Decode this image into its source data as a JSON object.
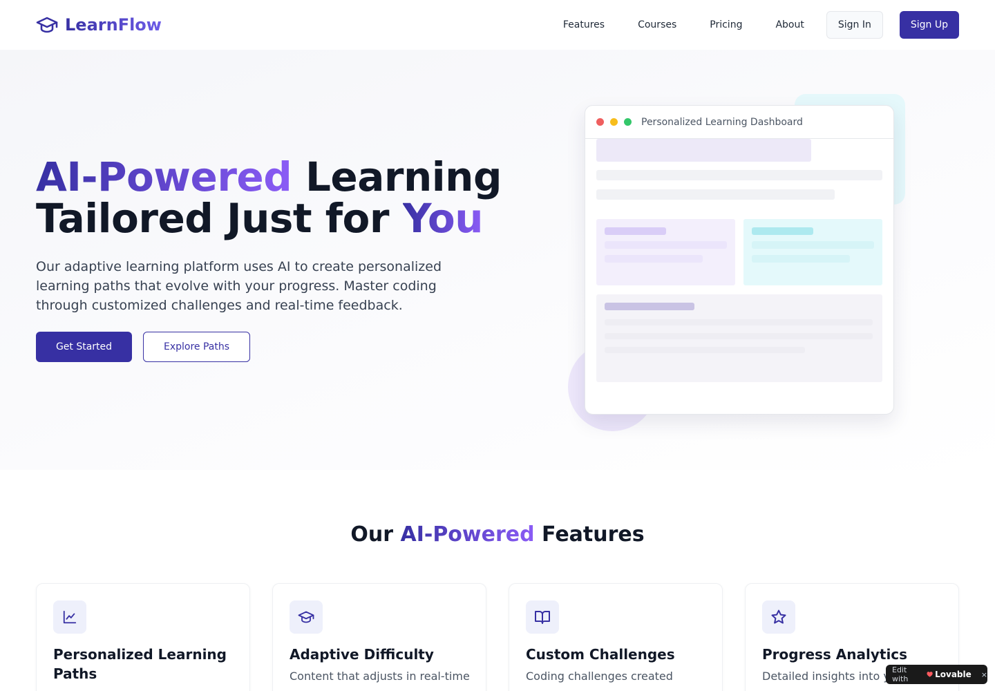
{
  "nav": {
    "brand": "LearnFlow",
    "links": [
      "Features",
      "Courses",
      "Pricing",
      "About"
    ],
    "sign_in": "Sign In",
    "sign_up": "Sign Up"
  },
  "hero": {
    "title_part1": "AI-Powered",
    "title_part2": " Learning",
    "title_part3": "Tailored Just for ",
    "title_part4": "You",
    "subtitle": "Our adaptive learning platform uses AI to create personalized learning paths that evolve with your progress. Master coding through customized challenges and real-time feedback.",
    "cta_primary": "Get Started",
    "cta_secondary": "Explore Paths",
    "dashboard_title": "Personalized Learning Dashboard"
  },
  "features": {
    "heading_part1": "Our ",
    "heading_part2": "AI-Powered",
    "heading_part3": " Features",
    "cards": [
      {
        "icon": "line-chart-icon",
        "title": "Personalized Learning Paths",
        "description": ""
      },
      {
        "icon": "graduation-cap-icon",
        "title": "Adaptive Difficulty",
        "description": "Content that adjusts in real-time"
      },
      {
        "icon": "book-open-icon",
        "title": "Custom Challenges",
        "description": "Coding challenges created"
      },
      {
        "icon": "star-icon",
        "title": "Progress Analytics",
        "description": "Detailed insights into yo"
      }
    ]
  },
  "badge": {
    "prefix": "Edit with",
    "brand": "Lovable",
    "close": "×"
  },
  "colors": {
    "primary": "#3730a3",
    "accent": "#8b5cf6",
    "dot_red": "#ef5f5f",
    "dot_yellow": "#f7bd1c",
    "dot_green": "#34c76a"
  }
}
